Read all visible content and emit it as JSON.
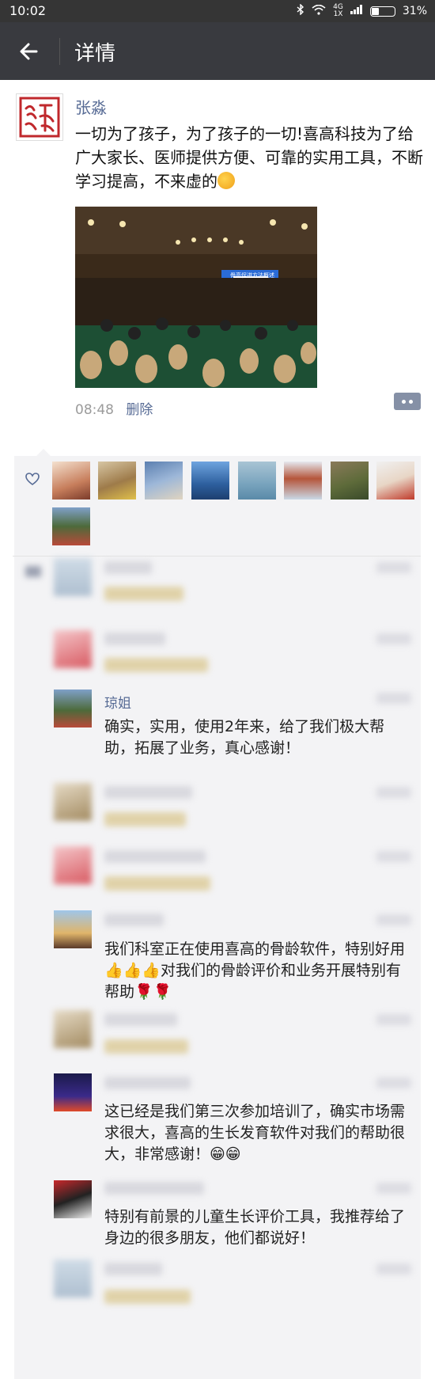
{
  "status_bar": {
    "time": "10:02",
    "battery": "31%",
    "signal": "4G",
    "carrier_note": "1X"
  },
  "nav": {
    "title": "详情"
  },
  "post": {
    "author": "张淼",
    "text": "一切为了孩子，为了孩子的一切!喜高科技为了给广大家长、医师提供方便、可靠的实用工具，不断学习提高，不来虚的",
    "photo_banner": "骨高促进方法概述",
    "time": "08:48",
    "delete_label": "删除"
  },
  "likes": {
    "icon": "heart-outline-icon",
    "count_visible": 9
  },
  "comments": [
    {
      "name": "",
      "text": "",
      "time": "",
      "blurred": true
    },
    {
      "name": "",
      "text": "",
      "time": "",
      "blurred": true
    },
    {
      "name": "琼姐",
      "text": "确实，实用，使用2年来，给了我们极大帮助，拓展了业务，真心感谢！",
      "time": "",
      "blurred": false
    },
    {
      "name": "",
      "text": "",
      "time": "",
      "blurred": true
    },
    {
      "name": "",
      "text": "",
      "time": "",
      "blurred": true
    },
    {
      "name": "",
      "text": "我们科室正在使用喜高的骨龄软件，特别好用👍👍👍对我们的骨龄评价和业务开展特别有帮助🌹🌹",
      "time": "",
      "blurred": false
    },
    {
      "name": "",
      "text": "",
      "time": "",
      "blurred": true
    },
    {
      "name": "",
      "text": "这已经是我们第三次参加培训了，确实市场需求很大，喜高的生长发育软件对我们的帮助很大，非常感谢！😁😁",
      "time": "",
      "blurred": false
    },
    {
      "name": "",
      "text": "特别有前景的儿童生长评价工具，我推荐给了身边的很多朋友，他们都说好！",
      "time": "",
      "blurred": false
    },
    {
      "name": "",
      "text": "",
      "time": "",
      "blurred": true
    }
  ],
  "colors": {
    "nav_bg": "#393a3f",
    "status_bg": "#353535",
    "link": "#576b95",
    "comment_bg": "#f3f3f5"
  }
}
